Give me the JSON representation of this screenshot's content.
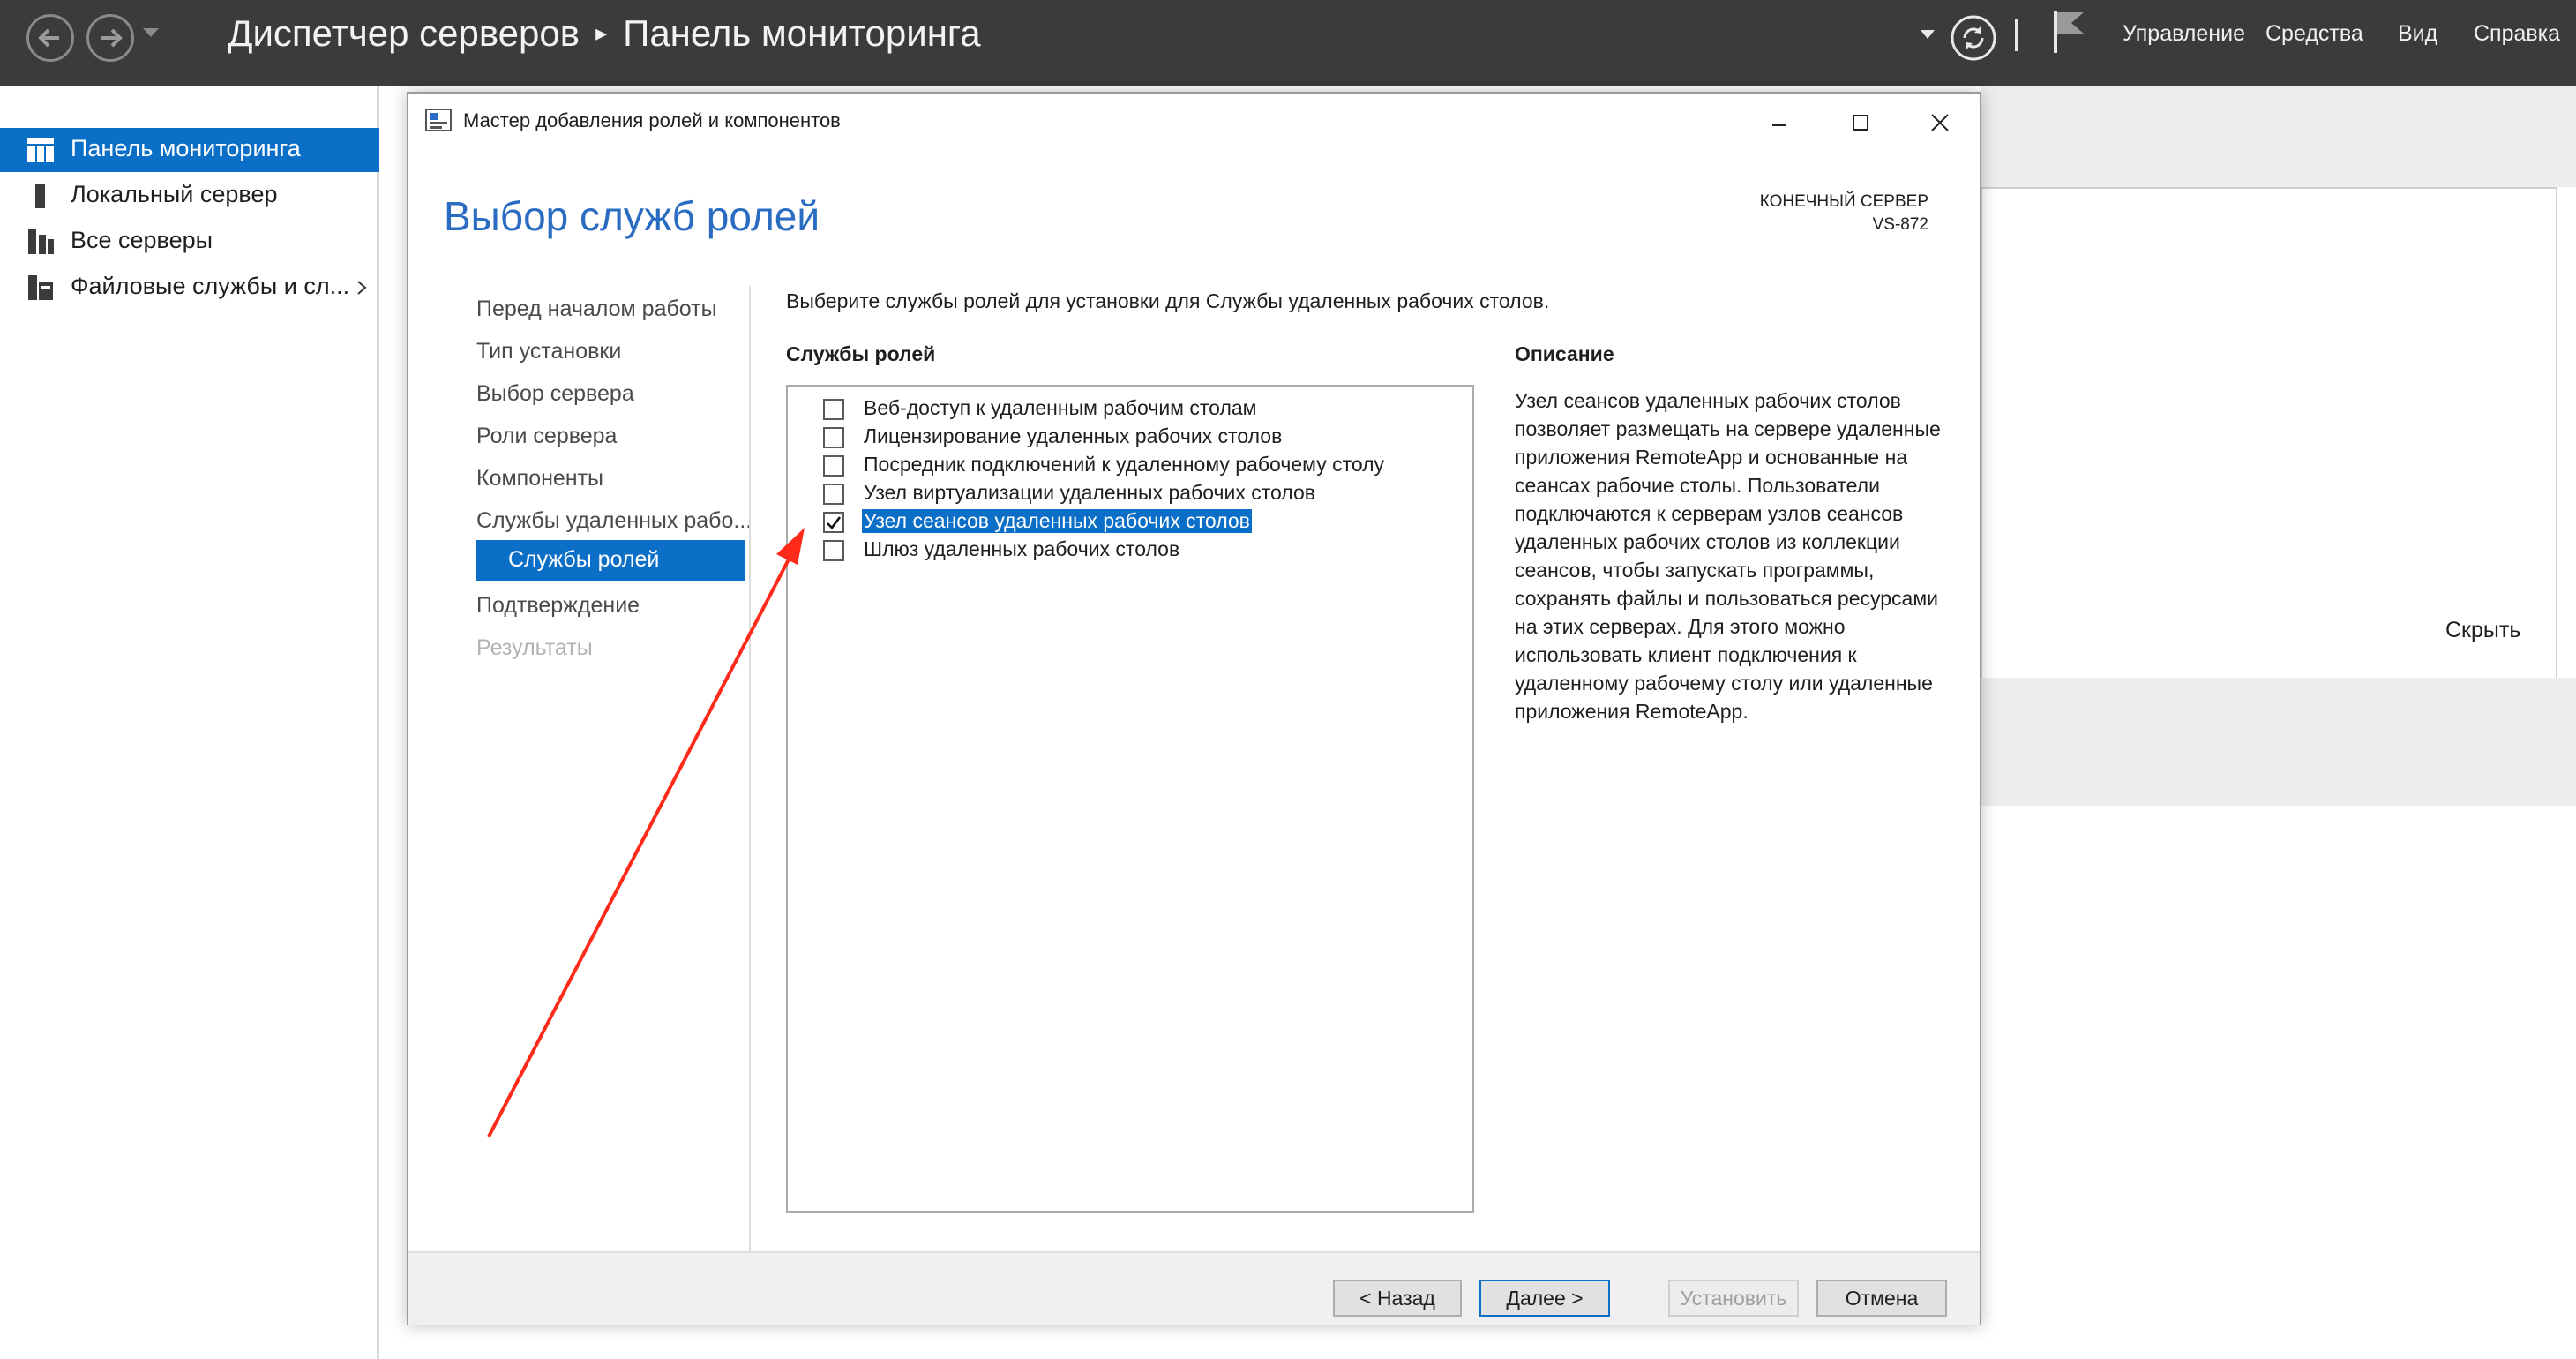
{
  "app": {
    "title_part1": "Диспетчер серверов",
    "title_part2": "Панель мониторинга",
    "menu": [
      "Управление",
      "Средства",
      "Вид",
      "Справка"
    ]
  },
  "sidebar": {
    "items": [
      {
        "label": "Панель мониторинга",
        "icon": "dashboard-icon",
        "active": true
      },
      {
        "label": "Локальный сервер",
        "icon": "server-icon"
      },
      {
        "label": "Все серверы",
        "icon": "servers-icon"
      },
      {
        "label": "Файловые службы и сл...",
        "icon": "file-services-icon"
      }
    ]
  },
  "background": {
    "hide_label": "Скрыть"
  },
  "dialog": {
    "window_title": "Мастер добавления ролей и компонентов",
    "heading": "Выбор служб ролей",
    "destination_label": "КОНЕЧНЫЙ СЕРВЕР",
    "destination_server": "VS-872",
    "steps": [
      {
        "label": "Перед началом работы"
      },
      {
        "label": "Тип установки"
      },
      {
        "label": "Выбор сервера"
      },
      {
        "label": "Роли сервера"
      },
      {
        "label": "Компоненты"
      },
      {
        "label": "Службы удаленных рабо..."
      },
      {
        "label": "Службы ролей",
        "active": true
      },
      {
        "label": "Подтверждение"
      },
      {
        "label": "Результаты",
        "disabled": true
      }
    ],
    "instruction": "Выберите службы ролей для установки для Службы удаленных рабочих столов.",
    "role_services_label": "Службы ролей",
    "role_services": [
      {
        "label": "Веб-доступ к удаленным рабочим столам",
        "checked": false
      },
      {
        "label": "Лицензирование удаленных рабочих столов",
        "checked": false
      },
      {
        "label": "Посредник подключений к удаленному рабочему столу",
        "checked": false
      },
      {
        "label": "Узел виртуализации удаленных рабочих столов",
        "checked": false
      },
      {
        "label": "Узел сеансов удаленных рабочих столов",
        "checked": true,
        "selected": true
      },
      {
        "label": "Шлюз удаленных рабочих столов",
        "checked": false
      }
    ],
    "description_label": "Описание",
    "description": "Узел сеансов удаленных рабочих столов позволяет размещать на сервере удаленные приложения RemoteApp и основанные на сеансах рабочие столы. Пользователи подключаются к серверам узлов сеансов удаленных рабочих столов из коллекции сеансов, чтобы запускать программы, сохранять файлы и пользоваться ресурсами на этих серверах. Для этого можно использовать клиент подключения к удаленному рабочему столу или удаленные приложения RemoteApp.",
    "buttons": {
      "back": "< Назад",
      "next": "Далее >",
      "install": "Установить",
      "cancel": "Отмена"
    }
  },
  "colors": {
    "accent": "#0b6fc7",
    "topbar": "#3b3b3b",
    "heading": "#2a6cc1",
    "annotation_arrow": "#ff2a1a"
  }
}
